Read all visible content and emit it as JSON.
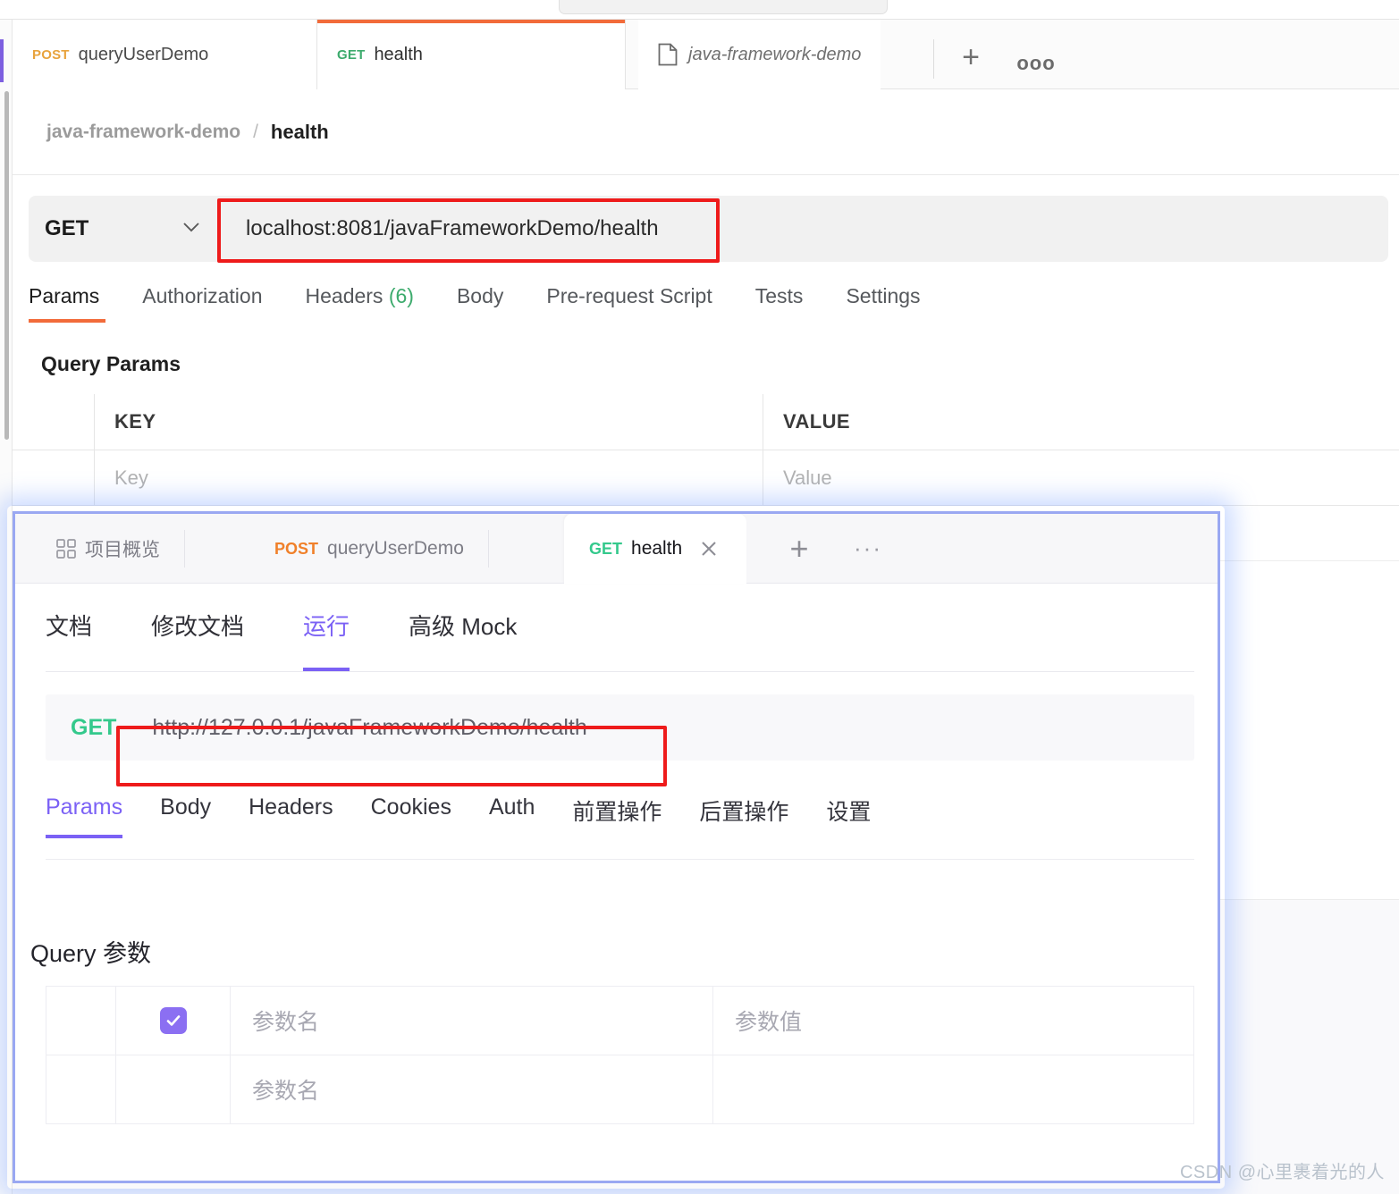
{
  "postman": {
    "search_placeholder": "",
    "tabs": [
      {
        "method": "POST",
        "name": "queryUserDemo",
        "active": false
      },
      {
        "method": "GET",
        "name": "health",
        "active": true
      }
    ],
    "collection_tab": {
      "icon": "folder-icon",
      "name": "java-framework-demo"
    },
    "new_tab_label": "+",
    "more_label": "ooo",
    "breadcrumb": {
      "root": "java-framework-demo",
      "separator": "/",
      "leaf": "health"
    },
    "request": {
      "method": "GET",
      "url": "localhost:8081/javaFrameworkDemo/health",
      "tabs": [
        {
          "label": "Params",
          "active": true
        },
        {
          "label": "Authorization",
          "active": false
        },
        {
          "label": "Headers",
          "count": "(6)",
          "active": false
        },
        {
          "label": "Body",
          "active": false
        },
        {
          "label": "Pre-request Script",
          "active": false
        },
        {
          "label": "Tests",
          "active": false
        },
        {
          "label": "Settings",
          "active": false
        }
      ],
      "headers_label": "Headers",
      "headers_count": "(6)",
      "query_params_title": "Query Params",
      "table": {
        "headers": {
          "key": "KEY",
          "value": "VALUE"
        },
        "placeholders": {
          "key": "Key",
          "value": "Value"
        }
      }
    }
  },
  "apifox": {
    "tabs": [
      {
        "icon": "grid-icon",
        "name": "项目概览",
        "active": false
      },
      {
        "method": "POST",
        "name": "queryUserDemo",
        "active": false
      },
      {
        "method": "GET",
        "name": "health",
        "active": true,
        "close": "✕"
      }
    ],
    "new_tab_label": "+",
    "more_label": "···",
    "subtabs": [
      {
        "label": "文档",
        "active": false
      },
      {
        "label": "修改文档",
        "active": false
      },
      {
        "label": "运行",
        "active": true
      },
      {
        "label": "高级 Mock",
        "active": false
      }
    ],
    "request": {
      "method": "GET",
      "url": "http://127.0.0.1/javaFrameworkDemo/health",
      "tabs": [
        {
          "label": "Params",
          "active": true
        },
        {
          "label": "Body",
          "active": false
        },
        {
          "label": "Headers",
          "active": false
        },
        {
          "label": "Cookies",
          "active": false
        },
        {
          "label": "Auth",
          "active": false
        },
        {
          "label": "前置操作",
          "active": false
        },
        {
          "label": "后置操作",
          "active": false
        },
        {
          "label": "设置",
          "active": false
        }
      ],
      "query_params_title": "Query 参数",
      "table": {
        "rows": [
          {
            "checked": true,
            "name_placeholder": "参数名",
            "value_placeholder": "参数值"
          },
          {
            "checked": false,
            "name_placeholder": "参数名",
            "value_placeholder": ""
          }
        ]
      }
    }
  },
  "watermark": "CSDN @心里裹着光的人",
  "colors": {
    "postman_accent": "#f26b3a",
    "apifox_accent": "#7b61f5",
    "get_green": "#34c98c",
    "post_orange": "#f0802a",
    "highlight_red": "#ee1b1b",
    "overlay_border": "#9aa8f2"
  }
}
